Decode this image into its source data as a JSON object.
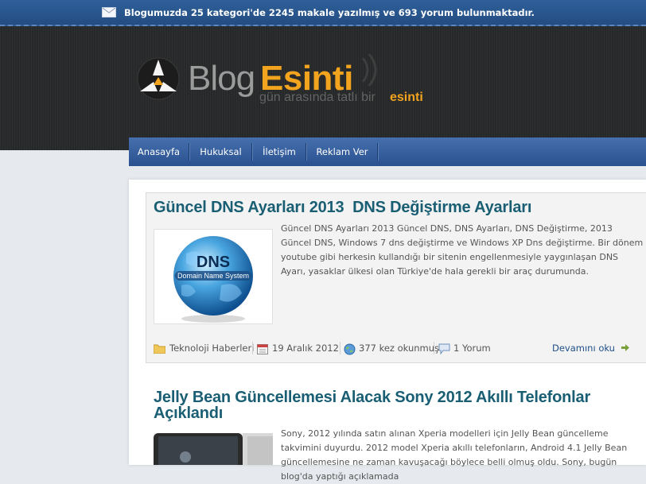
{
  "topbar": {
    "message": "Blogumuzda 25 kategori'de 2245 makale yazılmış ve 693 yorum bulunmaktadır."
  },
  "logo": {
    "blog": "Blog",
    "esinti": "Esinti",
    "slogan": "gün arasında tatlı bir",
    "slogan_emphasis": "esinti"
  },
  "nav": {
    "items": [
      "Anasayfa",
      "Hukuksal",
      "İletişim",
      "Reklam Ver"
    ]
  },
  "posts": [
    {
      "title": "Güncel DNS Ayarları 2013  DNS Değiştirme Ayarları",
      "excerpt": "Güncel DNS Ayarları 2013 Güncel DNS, DNS Ayarları, DNS Değiştirme, 2013 Güncel DNS, Windows 7 dns değiştirme ve Windows XP Dns değiştirme. Bir dönem youtube gibi herkesin kullandığı bir sitenin engellenmesiyle yaygınlaşan DNS Ayarı, yasaklar ülkesi olan Türkiye'de hala gerekli bir araç durumunda.",
      "thumb_title": "DNS",
      "thumb_subtitle": "Domain Name System",
      "category": "Teknoloji Haberleri",
      "date": "19 Aralık 2012",
      "views": "377 kez okunmuş",
      "comments": "1 Yorum",
      "read_more": "Devamını oku"
    },
    {
      "title_line1": "Jelly Bean Güncellemesi Alacak Sony 2012 Akıllı Telefonlar",
      "title_line2": "Açıklandı",
      "excerpt": "Sony, 2012 yılında satın alınan Xperia modelleri için Jelly Bean güncelleme takvimini duyurdu. 2012 model Xperia akıllı telefonların, Android 4.1 Jelly Bean güncellemesine ne zaman kavuşacağı böylece belli olmuş oldu. Sony, bugün blog'da yaptığı açıklamada"
    }
  ],
  "colors": {
    "topbar": "#2f5f99",
    "header": "#262829",
    "nav": "#3a629f",
    "accent": "#f2a41f",
    "title": "#195e73",
    "link": "#1f4f8a"
  },
  "icons": {
    "mail": "envelope-icon",
    "category": "folder-icon",
    "date": "calendar-icon",
    "views": "globe-icon",
    "comments": "speech-bubble-icon",
    "read_more": "arrow-right-icon"
  }
}
